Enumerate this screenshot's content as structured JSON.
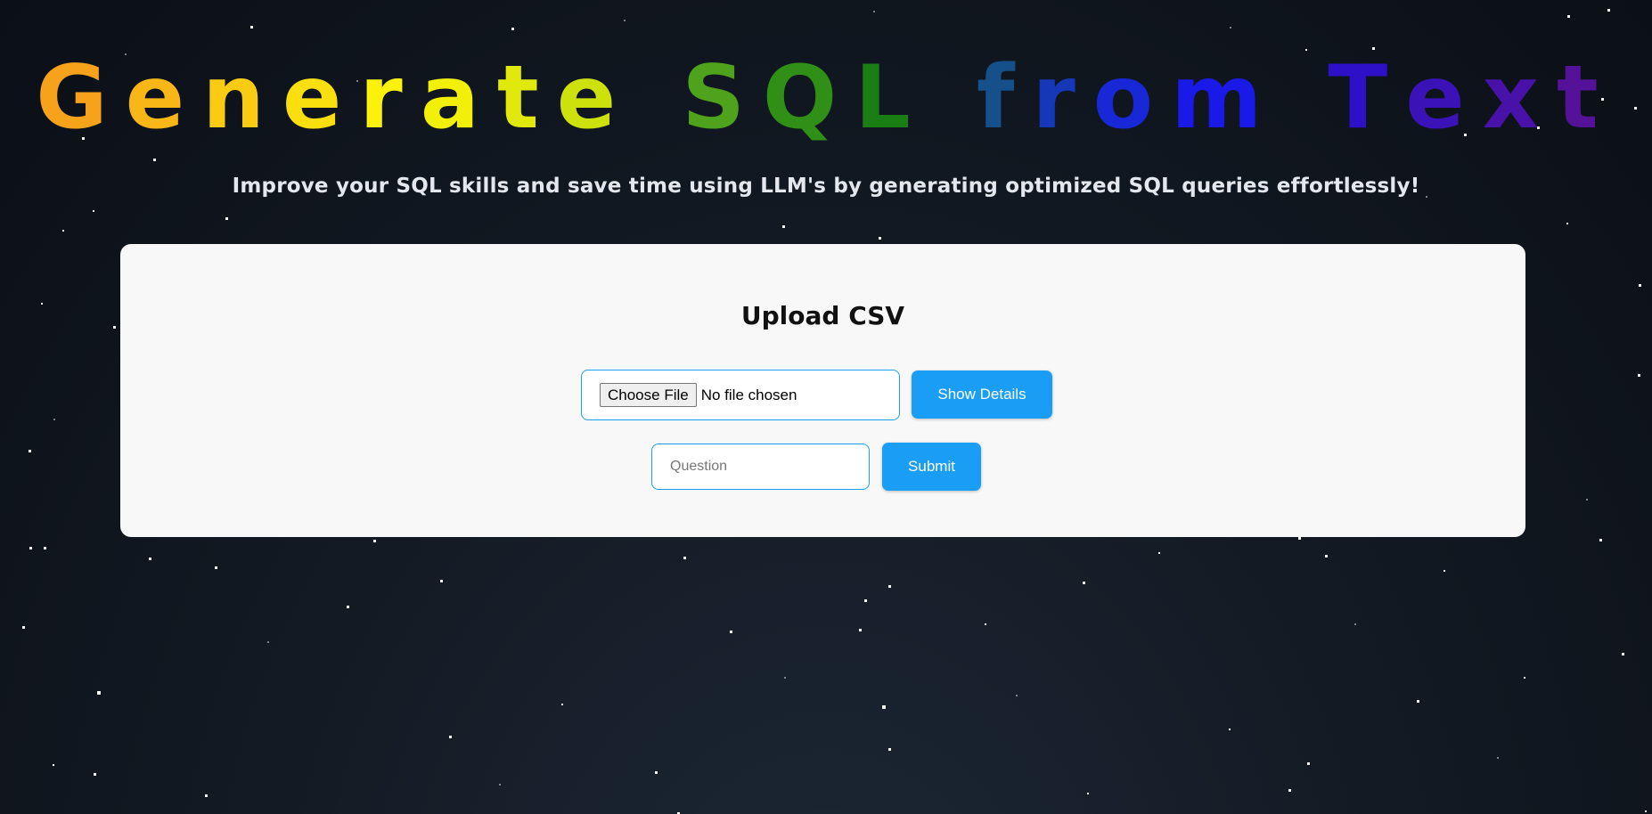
{
  "header": {
    "title_words": [
      {
        "text": "Generate",
        "colors": [
          "#f7a21b",
          "#f8b716",
          "#f9cb12",
          "#fadf0e",
          "#fbf10a",
          "#f2ef08",
          "#e0e90a",
          "#cde10c"
        ]
      },
      {
        "text": "SQL",
        "colors": [
          "#4fa21b",
          "#2f8f16",
          "#1b7e14"
        ]
      },
      {
        "text": "from",
        "colors": [
          "#15508a",
          "#1638b8",
          "#1828d6",
          "#1a1ae8"
        ]
      },
      {
        "text": "Text",
        "colors": [
          "#2e10c8",
          "#3a12b8",
          "#4812a8",
          "#541298"
        ]
      }
    ],
    "subtitle": "Improve your SQL skills and save time using LLM's by generating optimized SQL queries effortlessly!"
  },
  "card": {
    "heading": "Upload CSV",
    "file_input": {
      "button_label": "Choose File",
      "status": "No file chosen"
    },
    "show_details_label": "Show Details",
    "question_input": {
      "placeholder": "Question",
      "value": ""
    },
    "submit_label": "Submit"
  },
  "colors": {
    "accent": "#1a9ef5",
    "card_background": "#f8f8f8",
    "page_background": "#0b0f16"
  }
}
